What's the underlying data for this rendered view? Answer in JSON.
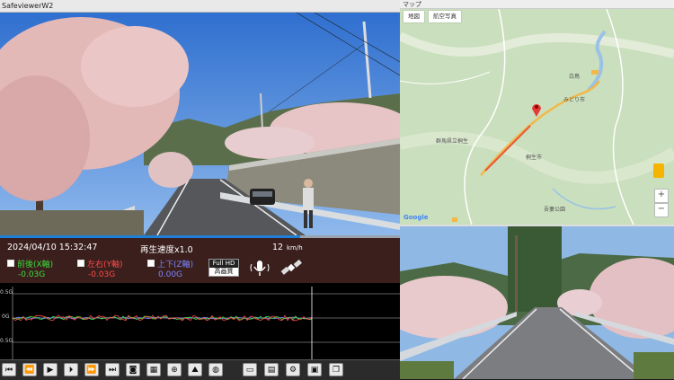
{
  "window": {
    "title": "SafeviewerW2"
  },
  "info": {
    "datetime": "2024/04/10 15:32:47",
    "speed_label": "再生速度x1.0",
    "speed_value": "12",
    "speed_unit": "km/h",
    "badge_top": "Full HD",
    "badge_bottom": "高画質",
    "axes": [
      {
        "label": "前後(X軸)",
        "value": "-0.03G",
        "color": "#3ddc3d"
      },
      {
        "label": "左右(Y軸)",
        "value": "-0.03G",
        "color": "#ff4a4a"
      },
      {
        "label": "上下(Z軸)",
        "value": "0.00G",
        "color": "#7b86ff"
      }
    ]
  },
  "progress": {
    "fraction": 0.75
  },
  "graph": {
    "y_top": "0.5G",
    "y_mid": "0G",
    "y_bottom": "0.5G"
  },
  "map": {
    "title": "マップ",
    "tabs": [
      "地図",
      "航空写真"
    ],
    "zoom_in": "+",
    "zoom_out": "−",
    "labels": [
      "白鳥",
      "みどり市",
      "桐生市",
      "群馬県立桐生",
      "吾妻公園"
    ]
  },
  "toolbar": {
    "buttons": [
      "skip-start",
      "rewind",
      "play",
      "step",
      "fast-forward",
      "skip-end",
      "snapshot",
      "film",
      "zoom",
      "road-image",
      "globe",
      "folder",
      "trash",
      "settings",
      "display",
      "window"
    ]
  },
  "colors": {
    "accent": "#1f7fd6",
    "info_bg": "#3a1f1d"
  }
}
